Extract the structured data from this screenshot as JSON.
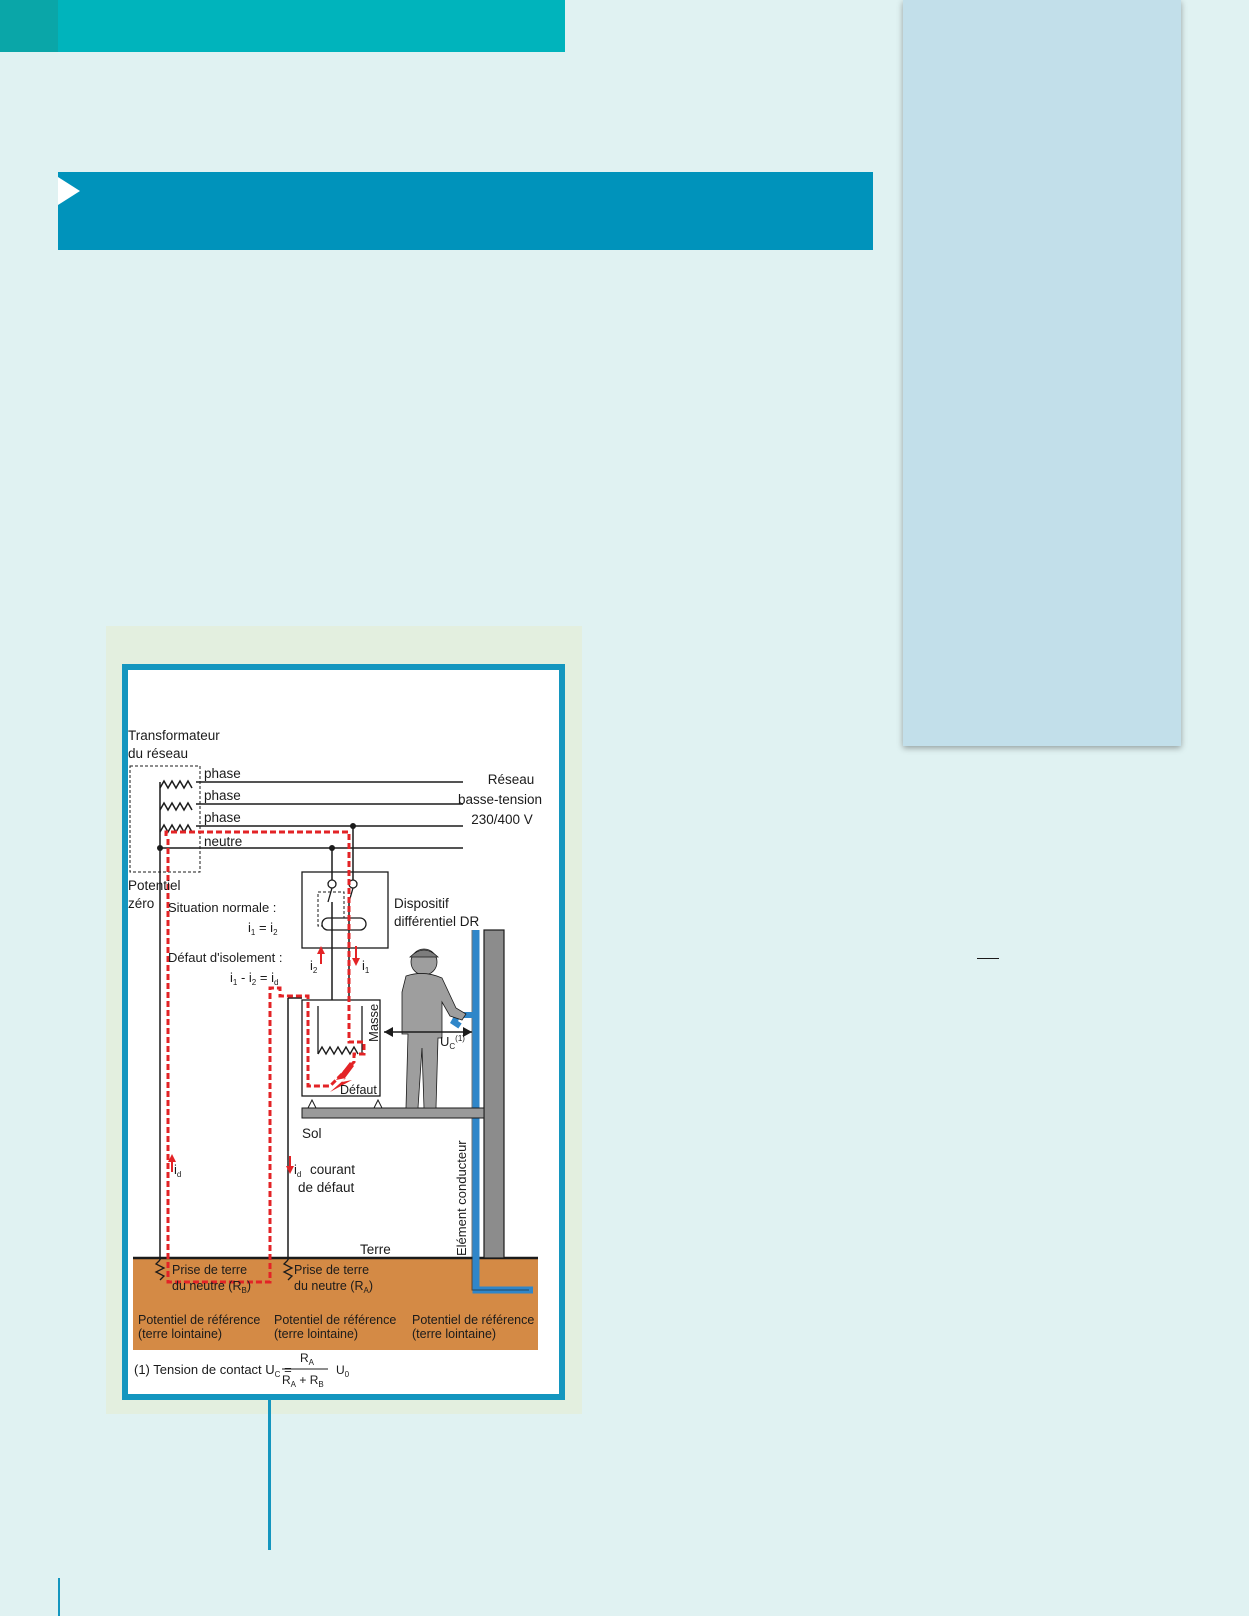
{
  "diagram": {
    "transformer_label_1": "Transformateur",
    "transformer_label_2": "du réseau",
    "line_phase_1": "phase",
    "line_phase_2": "phase",
    "line_phase_3": "phase",
    "line_neutral": "neutre",
    "network_label_1": "Réseau",
    "network_label_2": "basse-tension",
    "network_label_3": "230/400 V",
    "potential_zero_1": "Potentiel",
    "potential_zero_2": "zéro",
    "normal_situation": "Situation normale :",
    "normal_eq_i1": "i",
    "normal_eq_sub1": "1",
    "normal_eq_mid": " = i",
    "normal_eq_sub2": "2",
    "insulation_fault": "Défaut d'isolement :",
    "fault_eq_i": "i",
    "fault_eq_sub1": "1",
    "fault_eq_minus": " - i",
    "fault_eq_sub2": "2",
    "fault_eq_eq": " = i",
    "fault_eq_subd": "d",
    "device_label_1": "Dispositif",
    "device_label_2": "différentiel DR",
    "i2_label": "i",
    "i2_sub": "2",
    "i1_label": "i",
    "i1_sub": "1",
    "mass_label": "Masse",
    "fault_label": "Défaut",
    "uc_label": "U",
    "uc_sub": "C",
    "uc_sup": "(1)",
    "floor_label": "Sol",
    "id_label": "i",
    "id_sub": "d",
    "id_current_1": "courant",
    "id_current_2": "de défaut",
    "conductive_element": "Elément conducteur",
    "earth_label": "Terre",
    "earth_electrode_left_1": "Prise de terre",
    "earth_electrode_left_2": "du neutre (R",
    "earth_electrode_left_sub": "B",
    "earth_electrode_right_1": "Prise de terre",
    "earth_electrode_right_2": "du neutre (R",
    "earth_electrode_right_sub": "A",
    "ref_potential_1": "Potentiel de référence",
    "ref_potential_2": "(terre lointaine)",
    "footnote_prefix": "(1) Tension de contact U",
    "footnote_sub": "C",
    "footnote_eq": " =",
    "frac_num": "R",
    "frac_num_sub": "A",
    "frac_den": "R",
    "frac_den_sub1": "A",
    "frac_den_plus": " + R",
    "frac_den_sub2": "B",
    "frac_mult": "U",
    "frac_mult_sub": "0"
  },
  "colors": {
    "teal_band": "#00b4bc",
    "section_band": "#0093bb",
    "sidebar": "#c2dfea",
    "fault_path": "#e32326",
    "earth": "#d48a45",
    "pipe": "#2f86c9",
    "wall": "#8c8c8c"
  }
}
